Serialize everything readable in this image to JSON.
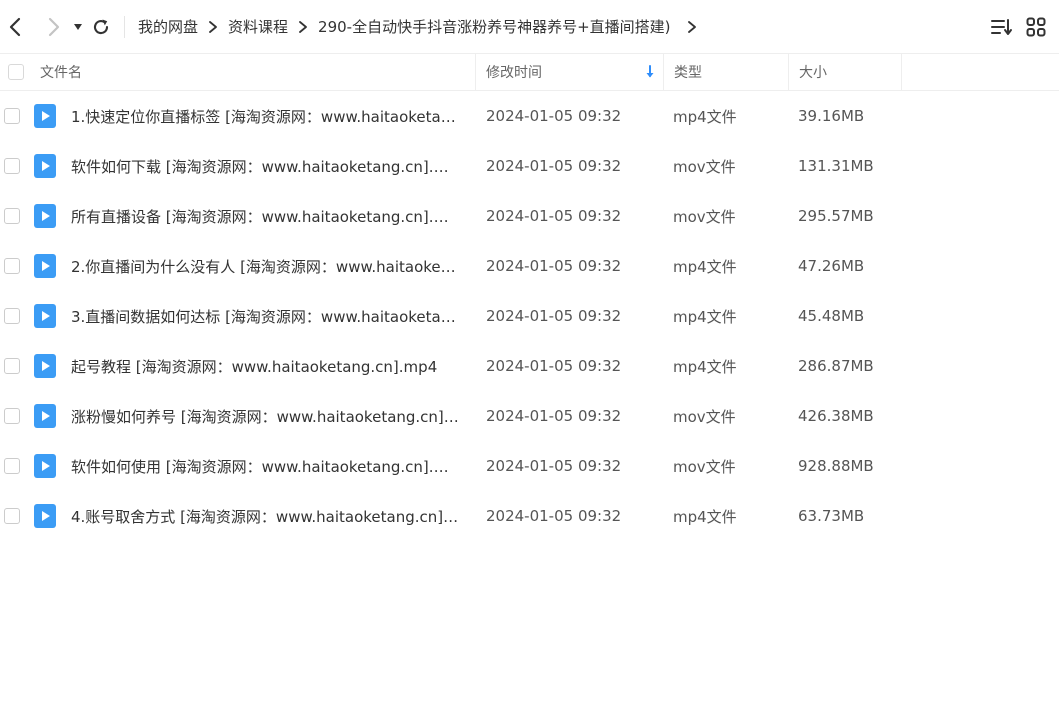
{
  "toolbar": {
    "back_icon": "chevron-left-icon",
    "forward_icon": "chevron-right-icon",
    "history_icon": "caret-down-icon",
    "refresh_icon": "refresh-icon",
    "breadcrumb": [
      "我的网盘",
      "资料课程",
      "290-全自动快手抖音涨粉养号神器养号+直播间搭建)"
    ],
    "sort_icon": "sort-list-icon",
    "view_icon": "grid-view-icon"
  },
  "header": {
    "name": "文件名",
    "time": "修改时间",
    "type": "类型",
    "size": "大小"
  },
  "colors": {
    "accent": "#2f8dfa",
    "file_icon": "#3b9cf5",
    "border": "#eeeeee"
  },
  "files": [
    {
      "name": "1.快速定位你直播标签 [海淘资源网：www.haitaoketan...",
      "time": "2024-01-05 09:32",
      "type": "mp4文件",
      "size": "39.16MB"
    },
    {
      "name": "软件如何下载 [海淘资源网：www.haitaoketang.cn].mov",
      "time": "2024-01-05 09:32",
      "type": "mov文件",
      "size": "131.31MB"
    },
    {
      "name": "所有直播设备 [海淘资源网：www.haitaoketang.cn].mov",
      "time": "2024-01-05 09:32",
      "type": "mov文件",
      "size": "295.57MB"
    },
    {
      "name": "2.你直播间为什么没有人 [海淘资源网：www.haitaoketa...",
      "time": "2024-01-05 09:32",
      "type": "mp4文件",
      "size": "47.26MB"
    },
    {
      "name": "3.直播间数据如何达标 [海淘资源网：www.haitaoketan...",
      "time": "2024-01-05 09:32",
      "type": "mp4文件",
      "size": "45.48MB"
    },
    {
      "name": "起号教程 [海淘资源网：www.haitaoketang.cn].mp4",
      "time": "2024-01-05 09:32",
      "type": "mp4文件",
      "size": "286.87MB"
    },
    {
      "name": "涨粉慢如何养号 [海淘资源网：www.haitaoketang.cn]....",
      "time": "2024-01-05 09:32",
      "type": "mov文件",
      "size": "426.38MB"
    },
    {
      "name": "软件如何使用 [海淘资源网：www.haitaoketang.cn].mov",
      "time": "2024-01-05 09:32",
      "type": "mov文件",
      "size": "928.88MB"
    },
    {
      "name": "4.账号取舍方式 [海淘资源网：www.haitaoketang.cn]....",
      "time": "2024-01-05 09:32",
      "type": "mp4文件",
      "size": "63.73MB"
    }
  ]
}
